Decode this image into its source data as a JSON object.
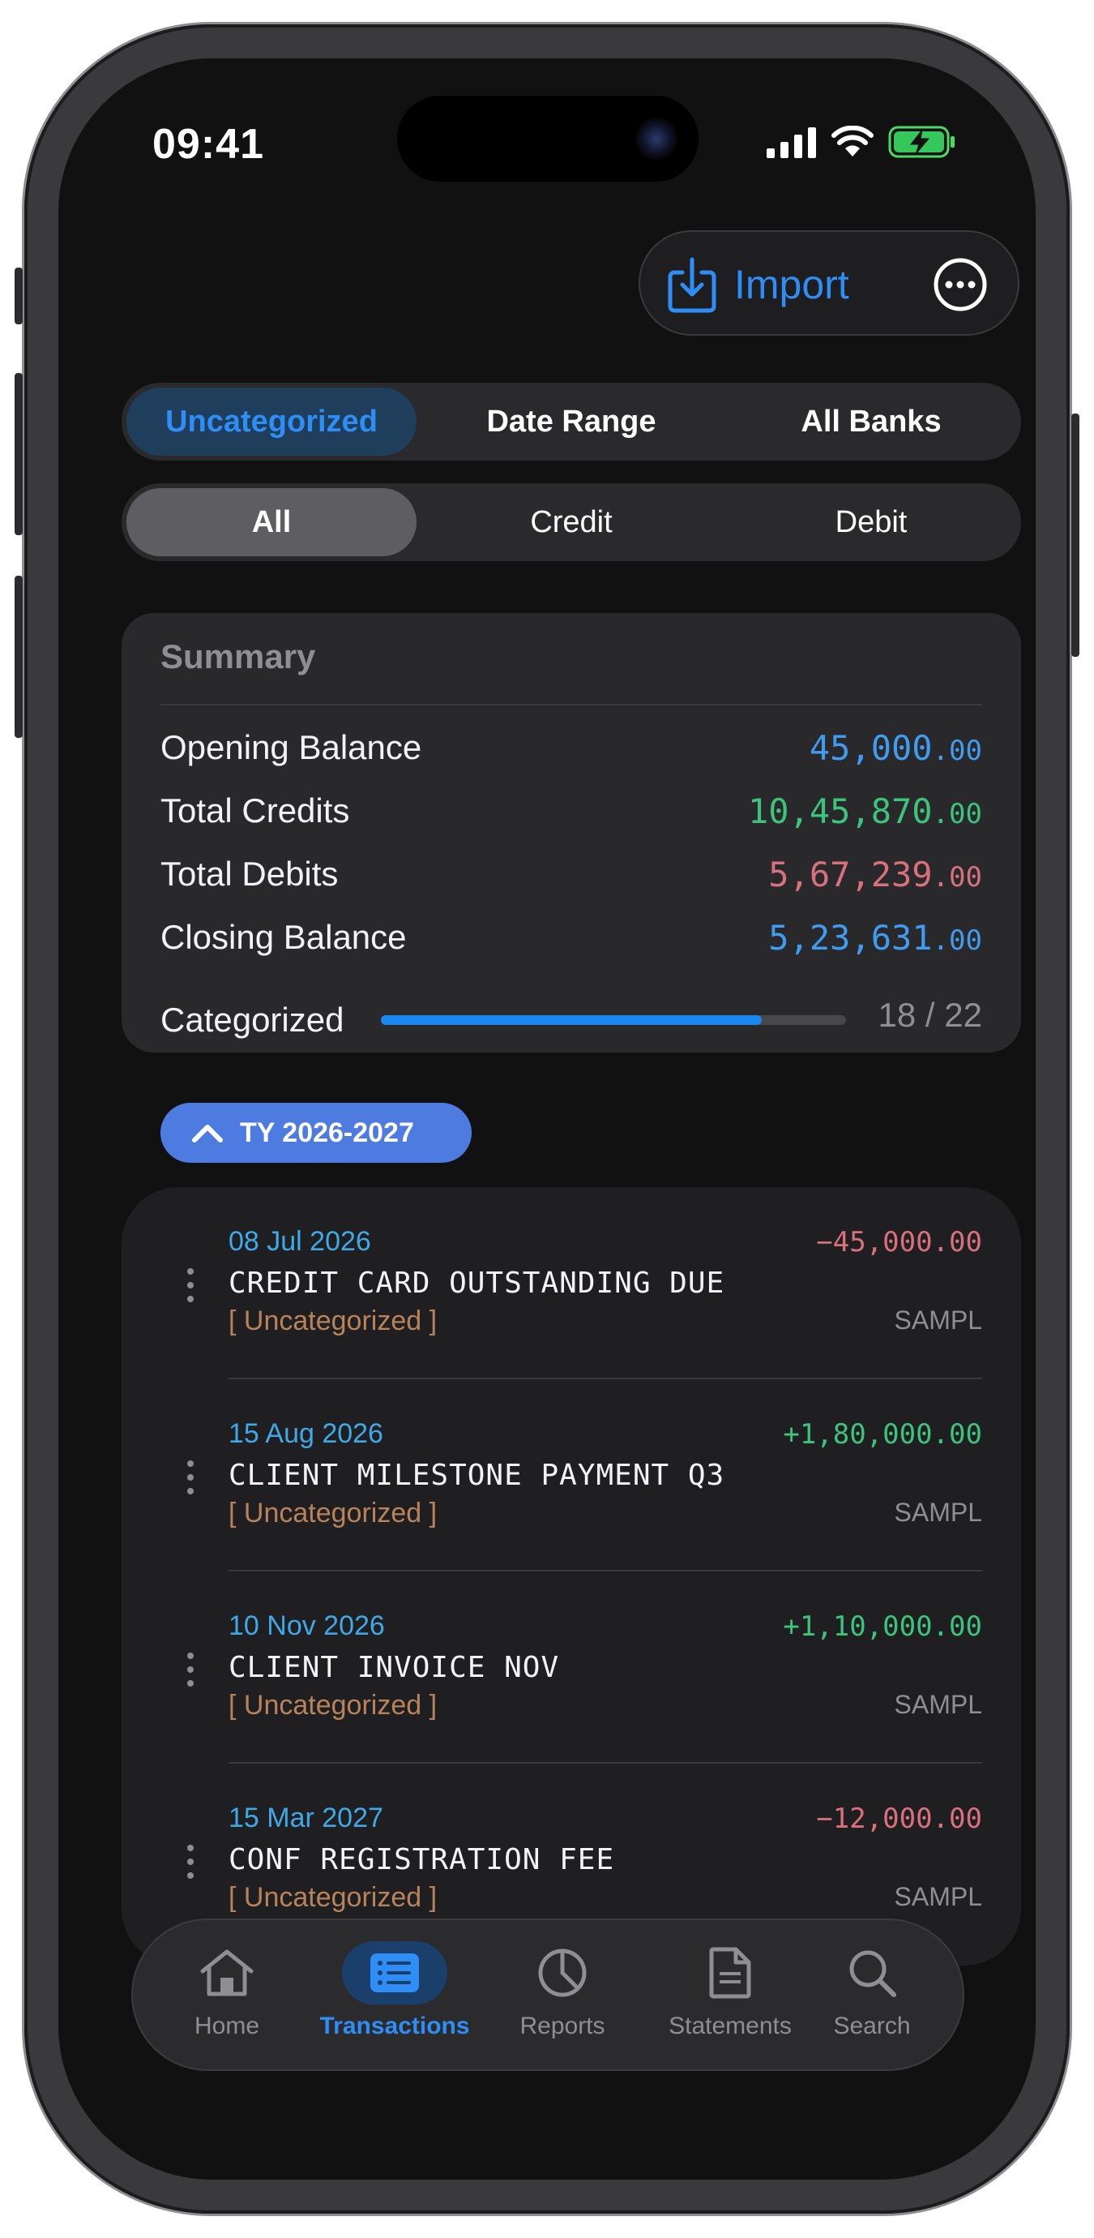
{
  "status_bar": {
    "time": "09:41"
  },
  "header": {
    "import_label": "Import"
  },
  "filters": {
    "row1": [
      "Uncategorized",
      "Date Range",
      "All Banks"
    ],
    "row1_active": "Uncategorized",
    "row2": [
      "All",
      "Credit",
      "Debit"
    ],
    "row2_active": "All"
  },
  "summary": {
    "title": "Summary",
    "opening": {
      "label": "Opening Balance",
      "int": "45,000",
      "dec": ".00"
    },
    "credits": {
      "label": "Total Credits",
      "int": "10,45,870",
      "dec": ".00"
    },
    "debits": {
      "label": "Total Debits",
      "int": "5,67,239",
      "dec": ".00"
    },
    "closing": {
      "label": "Closing Balance",
      "int": "5,23,631",
      "dec": ".00"
    },
    "categorized": {
      "label": "Categorized",
      "done": 18,
      "total": 22,
      "text": "18 / 22"
    }
  },
  "group": {
    "label": "TY 2026-2027"
  },
  "transactions": [
    {
      "date": "08 Jul 2026",
      "amount": "−45,000.00",
      "desc": "CREDIT CARD OUTSTANDING DUE",
      "category": "[ Uncategorized ]",
      "bank": "SAMPL",
      "type": "debit"
    },
    {
      "date": "15 Aug 2026",
      "amount": "+1,80,000.00",
      "desc": "CLIENT MILESTONE PAYMENT Q3",
      "category": "[ Uncategorized ]",
      "bank": "SAMPL",
      "type": "credit"
    },
    {
      "date": "10 Nov 2026",
      "amount": "+1,10,000.00",
      "desc": "CLIENT INVOICE NOV",
      "category": "[ Uncategorized ]",
      "bank": "SAMPL",
      "type": "credit"
    },
    {
      "date": "15 Mar 2027",
      "amount": "−12,000.00",
      "desc": "CONF REGISTRATION FEE",
      "category": "[ Uncategorized ]",
      "bank": "SAMPL",
      "type": "debit"
    }
  ],
  "tabs": [
    {
      "label": "Home",
      "icon": "home-icon"
    },
    {
      "label": "Transactions",
      "icon": "list-icon"
    },
    {
      "label": "Reports",
      "icon": "pie-chart-icon"
    },
    {
      "label": "Statements",
      "icon": "document-icon"
    },
    {
      "label": "Search",
      "icon": "search-icon"
    }
  ],
  "tabs_active": "Transactions",
  "colors": {
    "accent": "#2f8ef5",
    "credit": "#3cc47c",
    "debit": "#d9707e",
    "balance": "#3f9cf0",
    "date": "#3fa9e8",
    "category": "#b8835a"
  }
}
